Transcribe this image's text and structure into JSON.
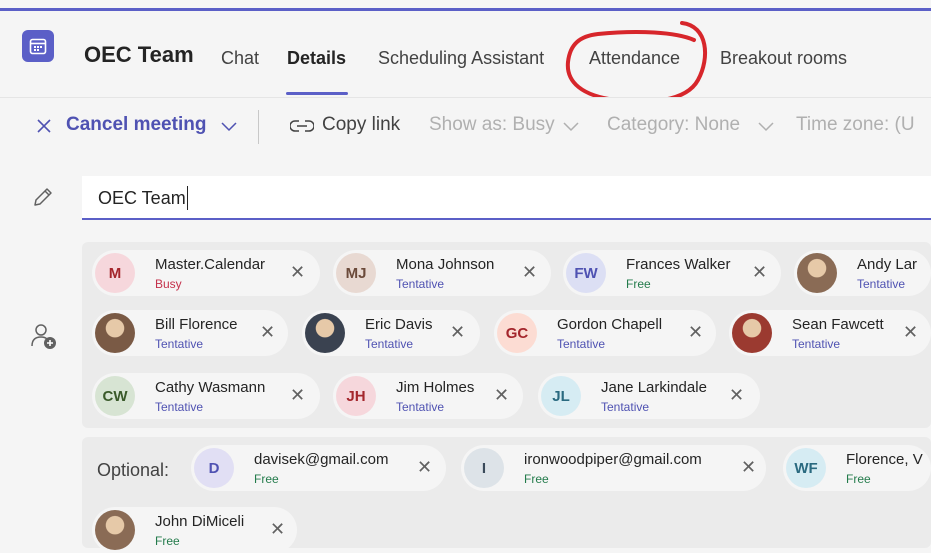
{
  "header": {
    "title": "OEC Team",
    "tabs": [
      {
        "label": "Chat"
      },
      {
        "label": "Details"
      },
      {
        "label": "Scheduling Assistant"
      },
      {
        "label": "Attendance"
      },
      {
        "label": "Breakout rooms"
      }
    ]
  },
  "toolbar": {
    "cancel_label": "Cancel meeting",
    "copy_link_label": "Copy link",
    "show_as_label": "Show as: Busy",
    "category_label": "Category: None",
    "timezone_label": "Time zone: (U"
  },
  "meeting": {
    "title_value": "OEC Team"
  },
  "attendees": [
    {
      "initials": "M",
      "name": "Master.Calendar",
      "status": "Busy",
      "avatar_bg": "#f6d7dc",
      "avatar_fg": "#a4262c"
    },
    {
      "initials": "MJ",
      "name": "Mona Johnson",
      "status": "Tentative",
      "avatar_bg": "#e8d9d2",
      "avatar_fg": "#6b4a3a"
    },
    {
      "initials": "FW",
      "name": "Frances Walker",
      "status": "Free",
      "avatar_bg": "#dcdff4",
      "avatar_fg": "#4f52b2"
    },
    {
      "initials": "",
      "name": "Andy Lar",
      "status": "Tentative",
      "photo": true
    },
    {
      "initials": "",
      "name": "Bill Florence",
      "status": "Tentative",
      "photo": true
    },
    {
      "initials": "",
      "name": "Eric Davis",
      "status": "Tentative",
      "photo": true
    },
    {
      "initials": "GC",
      "name": "Gordon Chapell",
      "status": "Tentative",
      "avatar_bg": "#fcdcd3",
      "avatar_fg": "#a4262c"
    },
    {
      "initials": "",
      "name": "Sean Fawcett",
      "status": "Tentative",
      "photo": true
    },
    {
      "initials": "CW",
      "name": "Cathy Wasmann",
      "status": "Tentative",
      "avatar_bg": "#d7e4d3",
      "avatar_fg": "#3a5a2a"
    },
    {
      "initials": "JH",
      "name": "Jim Holmes",
      "status": "Tentative",
      "avatar_bg": "#f6d7dc",
      "avatar_fg": "#a4262c"
    },
    {
      "initials": "JL",
      "name": "Jane Larkindale",
      "status": "Tentative",
      "avatar_bg": "#d6ecf3",
      "avatar_fg": "#2a6a80"
    }
  ],
  "optional": {
    "label": "Optional:",
    "attendees": [
      {
        "initials": "D",
        "name": "davisek@gmail.com",
        "status": "Free",
        "avatar_bg": "#e1dff4",
        "avatar_fg": "#4f52b2"
      },
      {
        "initials": "I",
        "name": "ironwoodpiper@gmail.com",
        "status": "Free",
        "avatar_bg": "#dde3e8",
        "avatar_fg": "#3a4a5a"
      },
      {
        "initials": "WF",
        "name": "Florence, V",
        "status": "Free",
        "avatar_bg": "#d6ecf3",
        "avatar_fg": "#2a6a80"
      },
      {
        "initials": "",
        "name": "John DiMiceli",
        "status": "Free",
        "photo": true
      }
    ]
  },
  "status_colors": {
    "Busy": "#c4314b",
    "Tentative": "#4f52b2",
    "Free": "#237b4b"
  },
  "icons": [
    "calendar-icon",
    "close-icon",
    "chevron-down-icon",
    "link-icon",
    "pencil-icon",
    "add-person-icon"
  ]
}
